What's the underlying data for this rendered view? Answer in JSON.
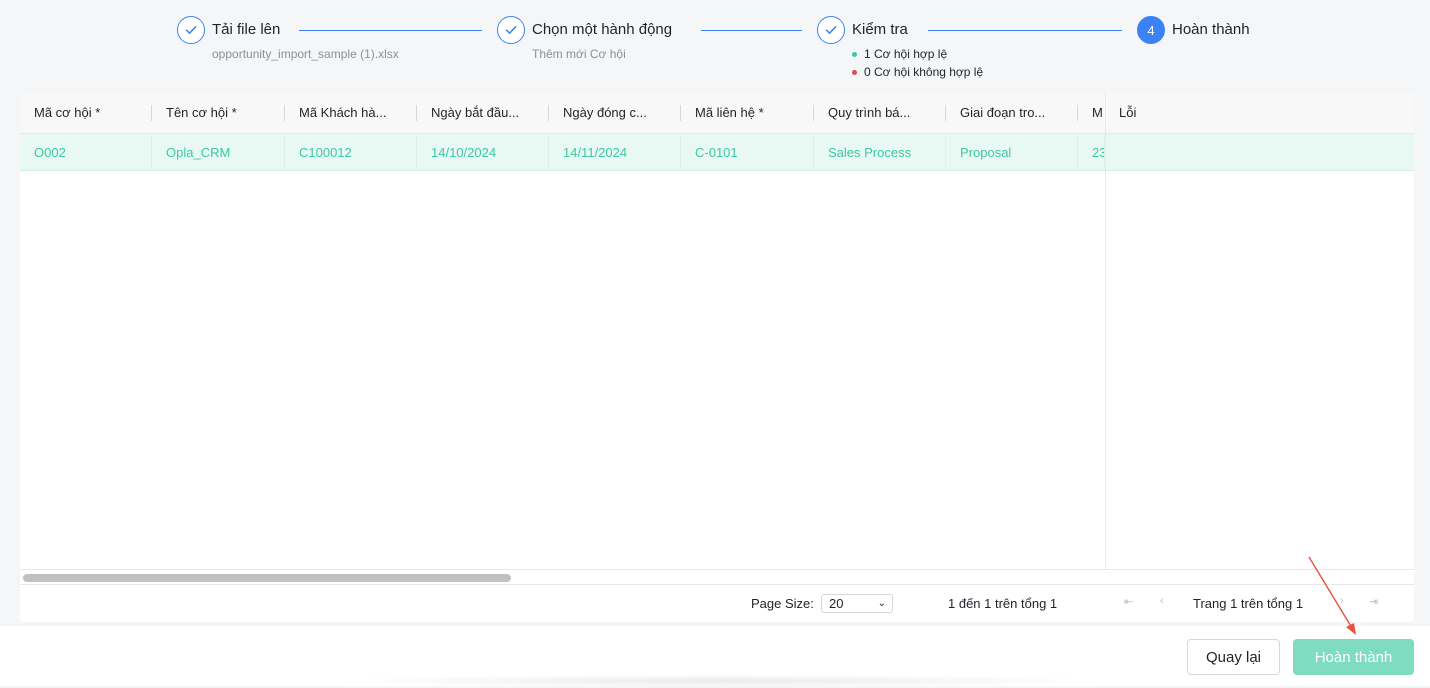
{
  "stepper": {
    "steps": [
      {
        "title": "Tải file lên",
        "subtitle": "opportunity_import_sample (1).xlsx",
        "state": "done"
      },
      {
        "title": "Chọn một hành động",
        "subtitle": "Thêm mới Cơ hội",
        "state": "done"
      },
      {
        "title": "Kiểm tra",
        "valid": "1 Cơ hội hợp lệ",
        "invalid": "0 Cơ hội không hợp lệ",
        "state": "done"
      },
      {
        "title": "Hoàn thành",
        "number": "4",
        "state": "active"
      }
    ]
  },
  "table": {
    "columns": [
      "Mã cơ hội *",
      "Tên cơ hội *",
      "Mã Khách hà...",
      "Ngày bắt đầu...",
      "Ngày đóng c...",
      "Mã liên hệ *",
      "Quy trình bá...",
      "Giai đoạn tro...",
      "M",
      "Lỗi"
    ],
    "rows": [
      [
        "O002",
        "Opla_CRM",
        "C100012",
        "14/10/2024",
        "14/11/2024",
        "C-0101",
        "Sales Process",
        "Proposal",
        "23",
        ""
      ]
    ]
  },
  "pager": {
    "page_size_label": "Page Size:",
    "page_size": "20",
    "range": "1 đến 1 trên tổng 1",
    "page_info": "Trang 1 trên tổng 1"
  },
  "footer": {
    "back_label": "Quay lại",
    "finish_label": "Hoàn thành"
  },
  "colors": {
    "primary": "#3b82f6",
    "success": "#3cc9a2",
    "danger": "#e5484d",
    "row_highlight": "#e8f8f3",
    "finish_button": "#7fdcc0",
    "annotation_arrow": "#e5533c"
  }
}
